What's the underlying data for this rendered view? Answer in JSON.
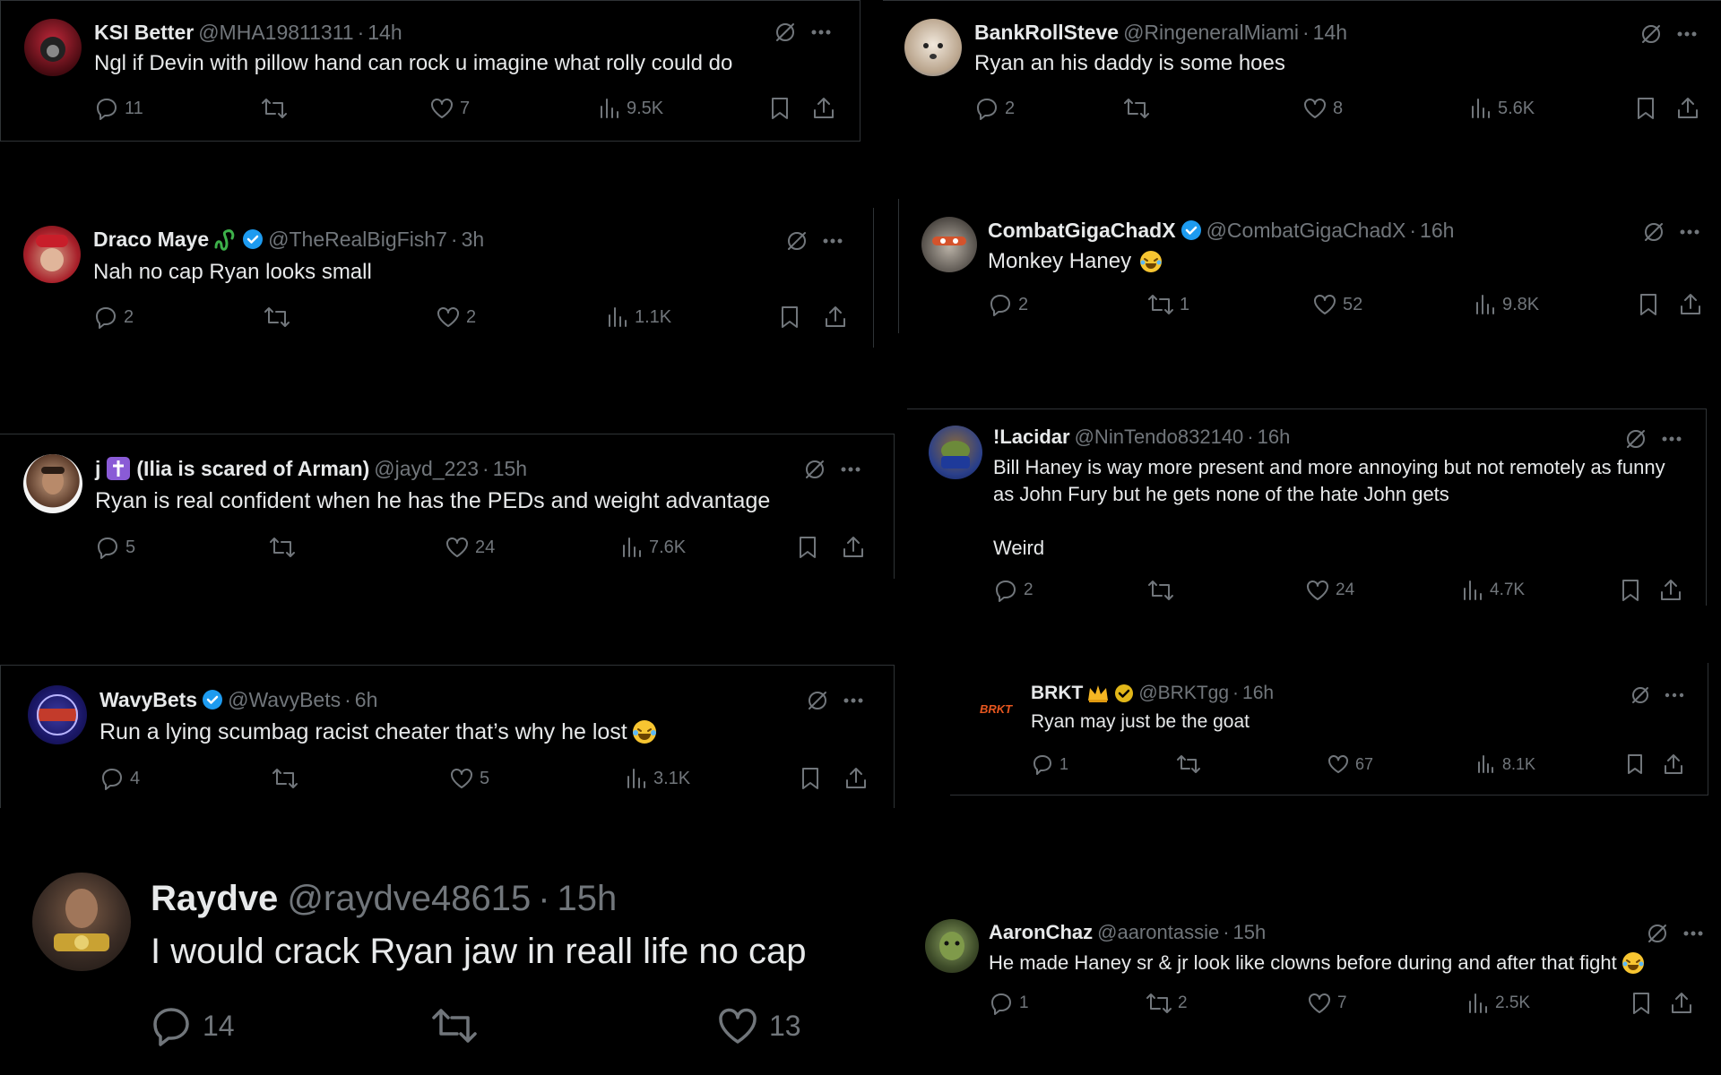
{
  "tweets": [
    {
      "name": "KSI Better",
      "handle": "@MHA19811311",
      "sep": "·",
      "time": "14h",
      "text": "Ngl if Devin with pillow hand can rock u imagine what rolly could do",
      "replies": "11",
      "retweets": "",
      "likes": "7",
      "views": "9.5K"
    },
    {
      "name": "BankRollSteve",
      "handle": "@RingeneralMiami",
      "sep": "·",
      "time": "14h",
      "text": "Ryan an his daddy is some hoes",
      "replies": "2",
      "retweets": "",
      "likes": "8",
      "views": "5.6K"
    },
    {
      "name": "Draco Maye",
      "handle": "@TheRealBigFish7",
      "sep": "·",
      "time": "3h",
      "text": "Nah no cap Ryan looks small",
      "replies": "2",
      "retweets": "",
      "likes": "2",
      "views": "1.1K"
    },
    {
      "name": "CombatGigaChadX",
      "handle": "@CombatGigaChadX",
      "sep": "·",
      "time": "16h",
      "text": "Monkey Haney",
      "replies": "2",
      "retweets": "1",
      "likes": "52",
      "views": "9.8K"
    },
    {
      "name": "j",
      "name_suffix": "(Ilia is scared of Arman)",
      "handle": "@jayd_223",
      "sep": "·",
      "time": "15h",
      "text": "Ryan is real confident when he has the PEDs and weight advantage",
      "replies": "5",
      "retweets": "",
      "likes": "24",
      "views": "7.6K"
    },
    {
      "name": "!Lacidar",
      "handle": "@NinTendo832140",
      "sep": "·",
      "time": "16h",
      "text": "Bill Haney is way more present and more annoying but not remotely as funny as John Fury but he gets none of the hate John gets\n\nWeird",
      "replies": "2",
      "retweets": "",
      "likes": "24",
      "views": "4.7K"
    },
    {
      "name": "WavyBets",
      "handle": "@WavyBets",
      "sep": "·",
      "time": "6h",
      "text": "Run a lying scumbag racist cheater that’s why he lost",
      "replies": "4",
      "retweets": "",
      "likes": "5",
      "views": "3.1K"
    },
    {
      "name": "BRKT",
      "handle": "@BRKTgg",
      "sep": "·",
      "time": "16h",
      "text": "Ryan may just be the goat",
      "replies": "1",
      "retweets": "",
      "likes": "67",
      "views": "8.1K",
      "avatar_text": "BRKT"
    },
    {
      "name": "Raydve",
      "handle": "@raydve48615",
      "sep": "·",
      "time": "15h",
      "text": "I would crack Ryan jaw in reall life no cap",
      "replies": "14",
      "retweets": "",
      "likes": "13"
    },
    {
      "name": "AaronChaz",
      "handle": "@aarontassie",
      "sep": "·",
      "time": "15h",
      "text": "He made Haney sr & jr look like clowns before during and after that fight",
      "replies": "1",
      "retweets": "2",
      "likes": "7",
      "views": "2.5K"
    }
  ],
  "colors": {
    "background": "#000000",
    "text": "#e7e9ea",
    "muted": "#71767b",
    "verified": "#1d9bf0",
    "gold": "#e2b719",
    "border": "#2f3336"
  },
  "icons": [
    "grok-icon",
    "more-icon",
    "reply-icon",
    "retweet-icon",
    "like-icon",
    "views-icon",
    "bookmark-icon",
    "share-icon",
    "verified-badge-icon",
    "crown-emoji-icon",
    "laughing-emoji-icon",
    "snake-emoji-icon",
    "cross-emoji-icon"
  ]
}
